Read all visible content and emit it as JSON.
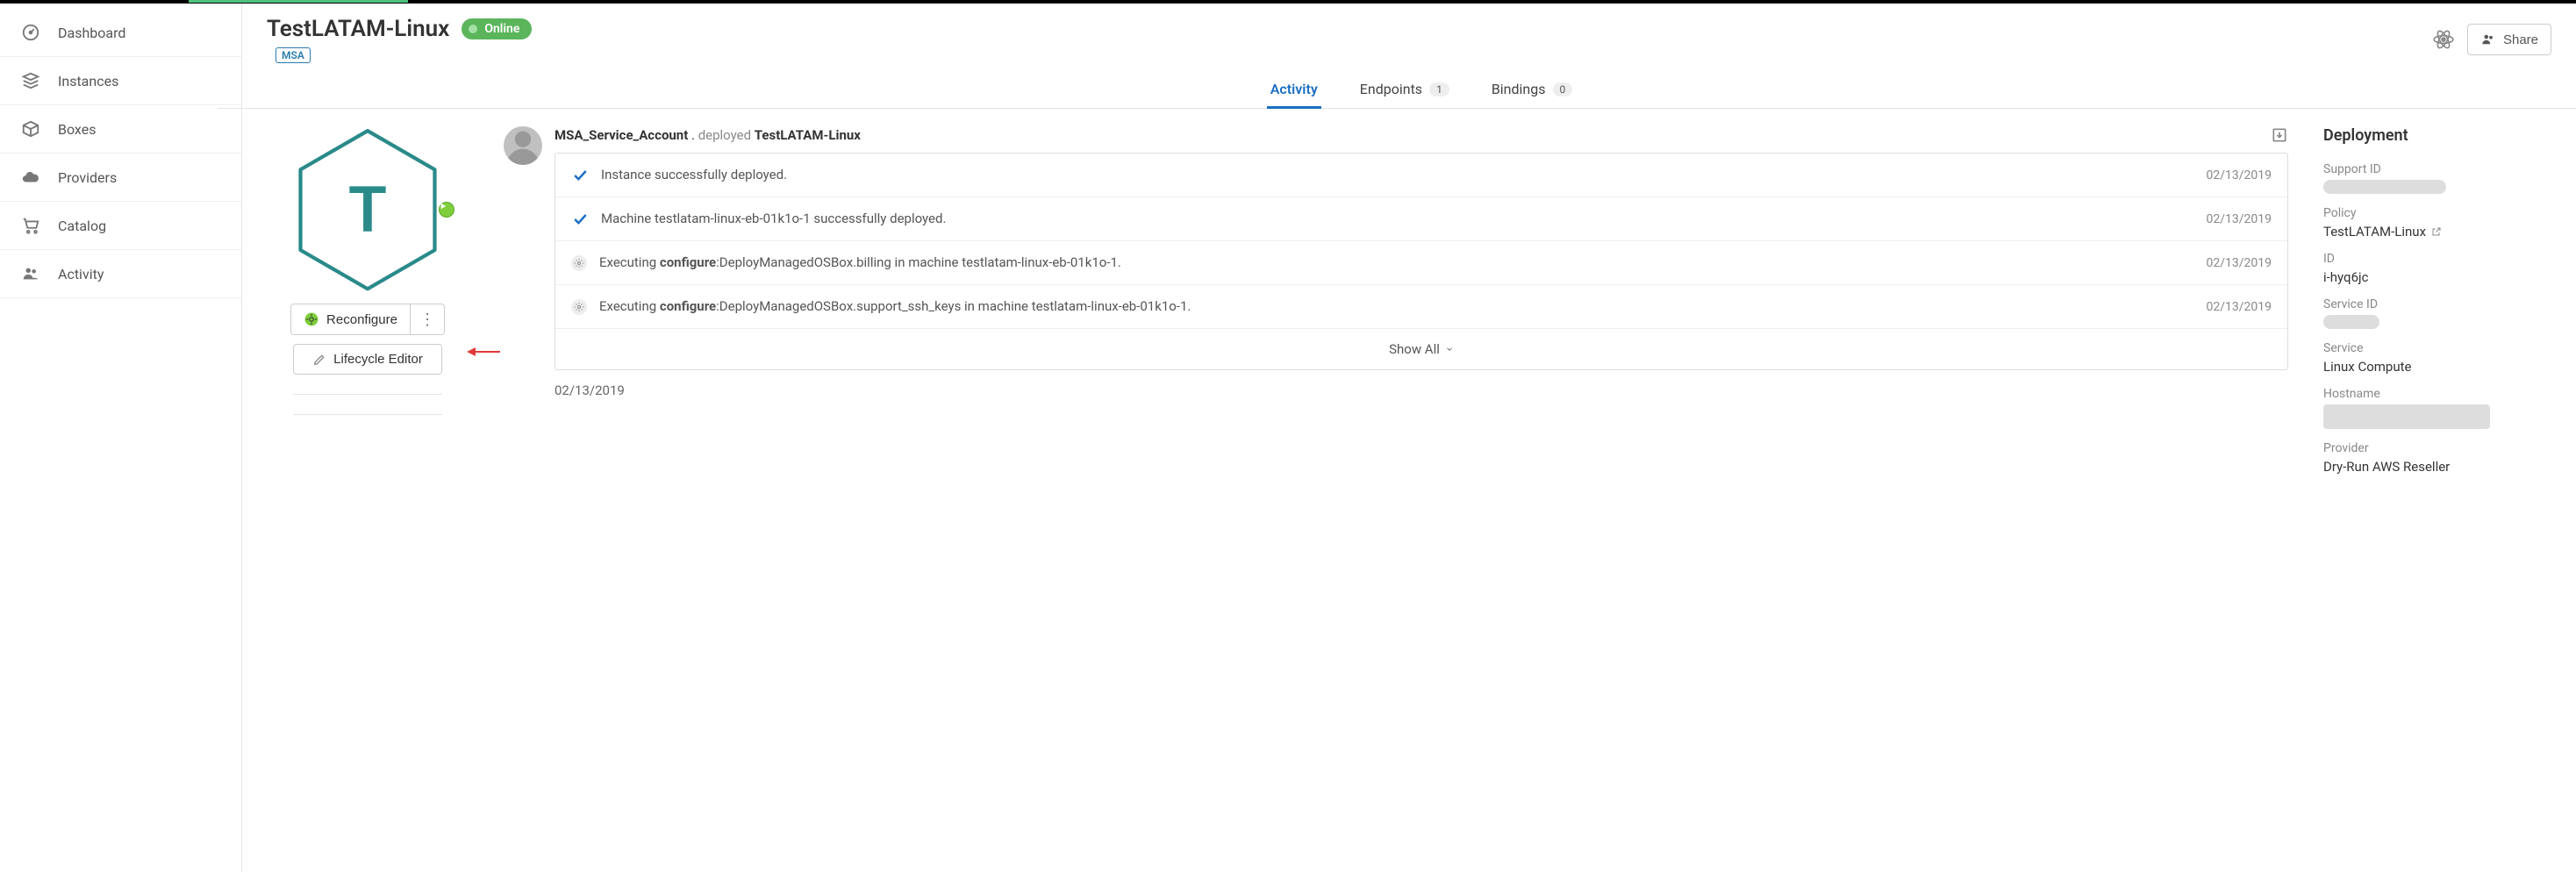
{
  "sidebar": {
    "items": [
      {
        "label": "Dashboard",
        "icon": "gauge"
      },
      {
        "label": "Instances",
        "icon": "stack"
      },
      {
        "label": "Boxes",
        "icon": "cube"
      },
      {
        "label": "Providers",
        "icon": "cloud"
      },
      {
        "label": "Catalog",
        "icon": "cart"
      },
      {
        "label": "Activity",
        "icon": "people"
      }
    ]
  },
  "header": {
    "title": "TestLATAM-Linux",
    "status": "Online",
    "msa_badge": "MSA",
    "share_label": "Share"
  },
  "hex_letter": "T",
  "actions": {
    "reconfigure": "Reconfigure",
    "lifecycle": "Lifecycle Editor"
  },
  "tabs": {
    "activity": "Activity",
    "endpoints": "Endpoints",
    "endpoints_count": "1",
    "bindings": "Bindings",
    "bindings_count": "0"
  },
  "feed": {
    "user": "MSA_Service_Account",
    "action_sep": " . ",
    "action_word": "deployed",
    "action_target": "TestLATAM-Linux",
    "rows": [
      {
        "icon": "check",
        "text_plain": "Instance successfully deployed.",
        "date": "02/13/2019"
      },
      {
        "icon": "check",
        "text_plain": "Machine testlatam-linux-eb-01k1o-1 successfully deployed.",
        "date": "02/13/2019"
      },
      {
        "icon": "gear",
        "prefix": "Executing ",
        "bold": "configure",
        "suffix": ":DeployManagedOSBox.billing in machine testlatam-linux-eb-01k1o-1.",
        "date": "02/13/2019"
      },
      {
        "icon": "gear",
        "prefix": "Executing ",
        "bold": "configure",
        "suffix": ":DeployManagedOSBox.support_ssh_keys in machine testlatam-linux-eb-01k1o-1.",
        "date": "02/13/2019"
      }
    ],
    "show_all": "Show All",
    "footer_date": "02/13/2019"
  },
  "meta": {
    "section_title": "Deployment",
    "support_id_label": "Support ID",
    "policy_label": "Policy",
    "policy_value": "TestLATAM-Linux",
    "id_label": "ID",
    "id_value": "i-hyq6jc",
    "service_id_label": "Service ID",
    "service_label": "Service",
    "service_value": "Linux Compute",
    "hostname_label": "Hostname",
    "provider_label": "Provider",
    "provider_value": "Dry-Run AWS Reseller"
  }
}
